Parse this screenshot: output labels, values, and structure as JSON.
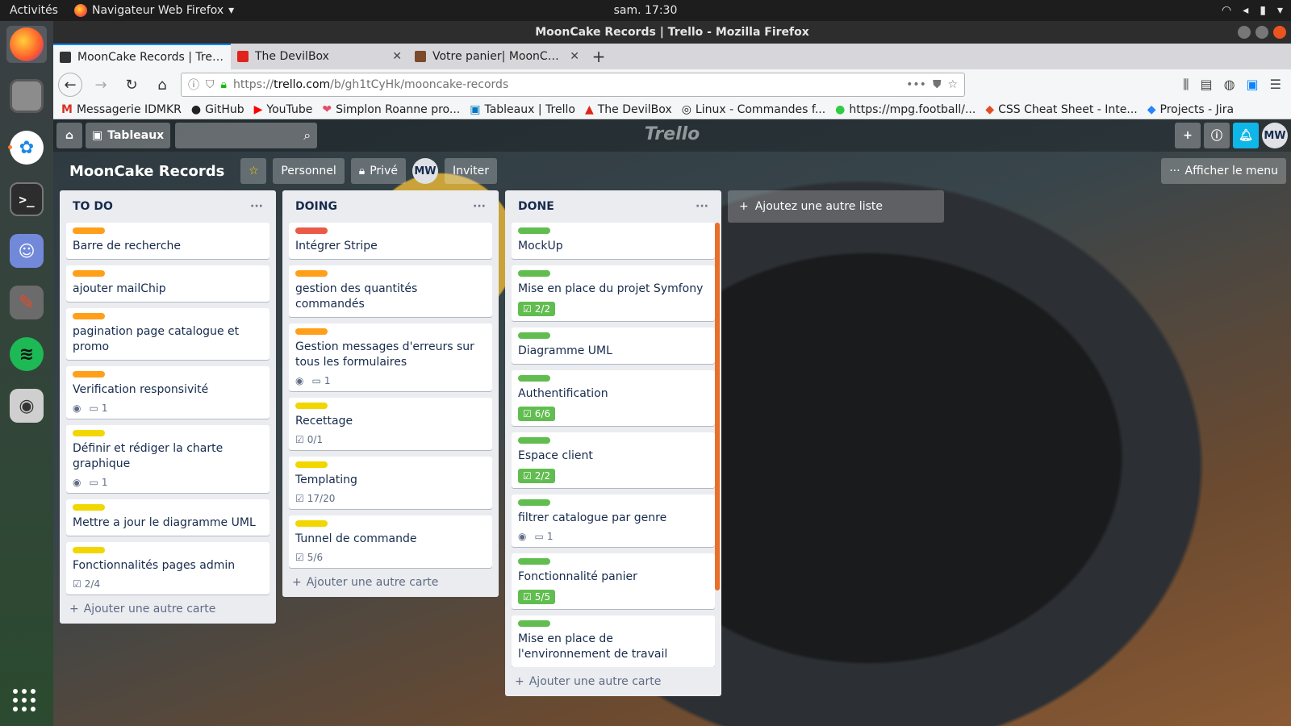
{
  "system": {
    "activities": "Activités",
    "app_name": "Navigateur Web Firefox",
    "clock": "sam. 17:30"
  },
  "window": {
    "title": "MoonCake Records | Trello - Mozilla Firefox"
  },
  "tabs": [
    {
      "label": "MoonCake Records | Trello",
      "active": true
    },
    {
      "label": "The DevilBox",
      "active": false
    },
    {
      "label": "Votre panier| MoonCake",
      "active": false
    }
  ],
  "urlbar": {
    "prefix": "https://",
    "host": "trello.com",
    "path": "/b/gh1tCyHk/mooncake-records"
  },
  "bookmarks": [
    {
      "label": "Messagerie IDMKR",
      "color": "#d93025"
    },
    {
      "label": "GitHub",
      "color": "#222222"
    },
    {
      "label": "YouTube",
      "color": "#ff0000"
    },
    {
      "label": "Simplon Roanne pro...",
      "color": "#e0526a"
    },
    {
      "label": "Tableaux | Trello",
      "color": "#0079bf"
    },
    {
      "label": "The DevilBox",
      "color": "#e0241b"
    },
    {
      "label": "Linux - Commandes f...",
      "color": "#555555"
    },
    {
      "label": "https://mpg.football/...",
      "color": "#2ecc40"
    },
    {
      "label": "CSS Cheat Sheet - Inte...",
      "color": "#e44d26"
    },
    {
      "label": "Projects - Jira",
      "color": "#2684ff"
    }
  ],
  "trello": {
    "boards_label": "Tableaux",
    "logo": "Trello",
    "avatar": "MW",
    "board_title": "MoonCake Records",
    "team": "Personnel",
    "visibility": "Privé",
    "invite": "Inviter",
    "show_menu": "Afficher le menu",
    "add_list": "Ajoutez une autre liste",
    "add_card": "Ajouter une autre carte"
  },
  "colors": {
    "orange": "#ff9f1a",
    "yellow": "#f2d600",
    "red": "#eb5a46",
    "green": "#61bd4f"
  },
  "lists": [
    {
      "name": "TO DO",
      "cards": [
        {
          "title": "Barre de recherche",
          "label": "orange"
        },
        {
          "title": "ajouter mailChip",
          "label": "orange"
        },
        {
          "title": "pagination page catalogue et promo",
          "label": "orange"
        },
        {
          "title": "Verification responsivité",
          "label": "orange",
          "watch": true,
          "comments": "1"
        },
        {
          "title": "Définir et rédiger la charte graphique",
          "label": "yellow",
          "watch": true,
          "comments": "1"
        },
        {
          "title": "Mettre a jour le diagramme UML",
          "label": "yellow"
        },
        {
          "title": "Fonctionnalités pages admin",
          "label": "yellow",
          "checklist": "2/4"
        }
      ]
    },
    {
      "name": "DOING",
      "cards": [
        {
          "title": "Intégrer Stripe",
          "label": "red"
        },
        {
          "title": "gestion des quantités commandés",
          "label": "orange"
        },
        {
          "title": "Gestion messages d'erreurs sur tous les formulaires",
          "label": "orange",
          "watch": true,
          "comments": "1"
        },
        {
          "title": "Recettage",
          "label": "yellow",
          "checklist": "0/1"
        },
        {
          "title": "Templating",
          "label": "yellow",
          "checklist": "17/20"
        },
        {
          "title": "Tunnel de commande",
          "label": "yellow",
          "checklist": "5/6"
        }
      ]
    },
    {
      "name": "DONE",
      "cards": [
        {
          "title": "MockUp",
          "label": "green"
        },
        {
          "title": "Mise en place du projet Symfony",
          "label": "green",
          "checklist": "2/2",
          "complete": true
        },
        {
          "title": "Diagramme UML",
          "label": "green"
        },
        {
          "title": "Authentification",
          "label": "green",
          "checklist": "6/6",
          "complete": true
        },
        {
          "title": "Espace client",
          "label": "green",
          "checklist": "2/2",
          "complete": true
        },
        {
          "title": "filtrer catalogue par genre",
          "label": "green",
          "watch": true,
          "comments": "1"
        },
        {
          "title": "Fonctionnalité panier",
          "label": "green",
          "checklist": "5/5",
          "complete": true
        },
        {
          "title": "Mise en place de l'environnement de travail",
          "label": "green"
        }
      ]
    }
  ]
}
